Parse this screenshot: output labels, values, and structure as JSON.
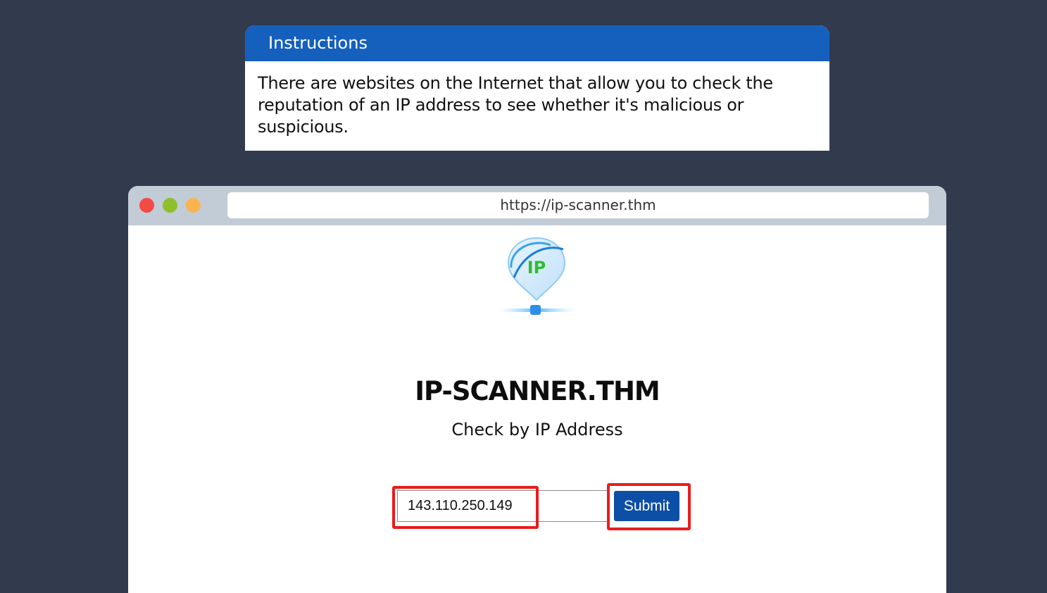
{
  "instructions": {
    "title": "Instructions",
    "body": "There are websites on the Internet that allow you to check the reputation of an IP address to see whether it's malicious or suspicious."
  },
  "browser": {
    "url": "https://ip-scanner.thm"
  },
  "site": {
    "logo_text": "IP",
    "title": "IP-SCANNER.THM",
    "subtitle": "Check by IP Address",
    "ip_input_value": "143.110.250.149",
    "submit_label": "Submit"
  },
  "colors": {
    "background": "#323a4e",
    "instructions_header": "#1560bd",
    "titlebar": "#c1ccd7",
    "submit_button": "#0d4ea6",
    "highlight": "#ea1c1c"
  }
}
